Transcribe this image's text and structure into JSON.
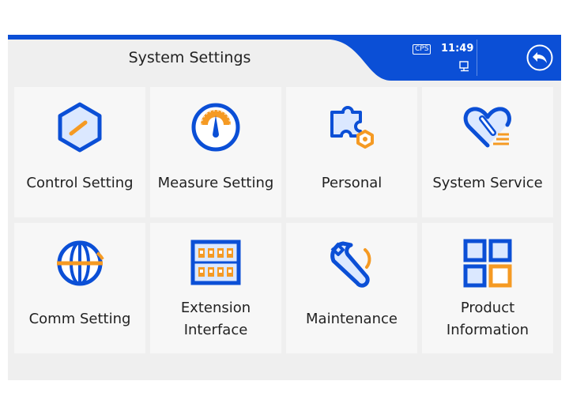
{
  "header": {
    "title": "System Settings",
    "cps_badge": "CPS",
    "time": "11:49"
  },
  "colors": {
    "accent": "#0b4fd6",
    "orange": "#f59a23",
    "tile_bg": "#f7f7f7",
    "screen_bg": "#efefef"
  },
  "tiles": [
    {
      "label": "Control Setting",
      "icon": "control-setting-icon"
    },
    {
      "label": "Measure Setting",
      "icon": "gauge-icon"
    },
    {
      "label": "Personal",
      "icon": "puzzle-gear-icon"
    },
    {
      "label": "System Service",
      "icon": "heart-wrench-icon"
    },
    {
      "label": "Comm Setting",
      "icon": "globe-icon"
    },
    {
      "label_line1": "Extension",
      "label_line2": "Interface",
      "icon": "extension-panel-icon"
    },
    {
      "label": "Maintenance",
      "icon": "wrench-icon"
    },
    {
      "label_line1": "Product",
      "label_line2": "Information",
      "icon": "grid-icon"
    }
  ]
}
